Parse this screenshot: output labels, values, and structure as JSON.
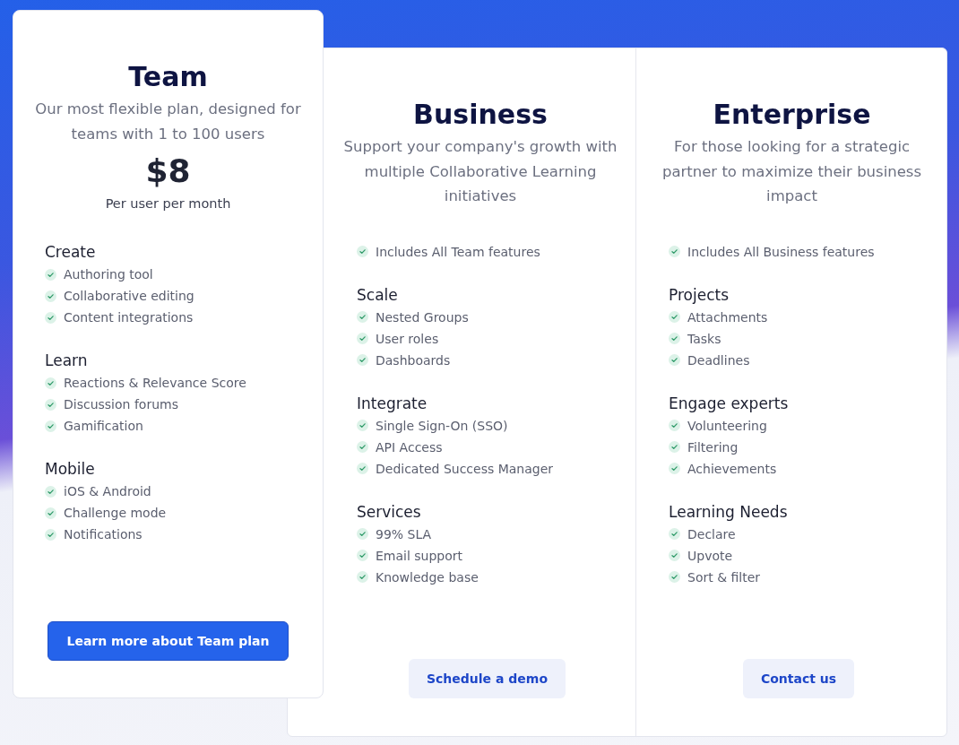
{
  "plans": [
    {
      "name": "Team",
      "description": "Our most flexible plan, designed for teams with 1 to 100 users",
      "price": "$8",
      "price_note": "Per user per month",
      "sections": [
        {
          "heading": "Create",
          "items": [
            "Authoring tool",
            "Collaborative editing",
            "Content integrations"
          ]
        },
        {
          "heading": "Learn",
          "items": [
            "Reactions & Relevance Score",
            "Discussion forums",
            "Gamification"
          ]
        },
        {
          "heading": "Mobile",
          "items": [
            "iOS & Android",
            "Challenge mode",
            "Notifications"
          ]
        }
      ],
      "cta": {
        "label": "Learn more about Team plan",
        "kind": "primary"
      }
    },
    {
      "name": "Business",
      "description": "Support your company's growth with multiple Collaborative Learning initiatives",
      "intro": "Includes All Team features",
      "sections": [
        {
          "heading": "Scale",
          "items": [
            "Nested Groups",
            "User roles",
            "Dashboards"
          ]
        },
        {
          "heading": "Integrate",
          "items": [
            "Single Sign-On (SSO)",
            "API Access",
            "Dedicated Success Manager"
          ]
        },
        {
          "heading": "Services",
          "items": [
            "99% SLA",
            "Email support",
            "Knowledge base"
          ]
        }
      ],
      "cta": {
        "label": "Schedule a demo",
        "kind": "secondary"
      }
    },
    {
      "name": "Enterprise",
      "description": "For those looking for a strategic partner to maximize their business impact",
      "intro": "Includes All Business features",
      "sections": [
        {
          "heading": "Projects",
          "items": [
            "Attachments",
            "Tasks",
            "Deadlines"
          ]
        },
        {
          "heading": "Engage experts",
          "items": [
            "Volunteering",
            "Filtering",
            "Achievements"
          ]
        },
        {
          "heading": "Learning Needs",
          "items": [
            "Declare",
            "Upvote",
            "Sort & filter"
          ]
        }
      ],
      "cta": {
        "label": "Contact us",
        "kind": "secondary"
      }
    }
  ]
}
